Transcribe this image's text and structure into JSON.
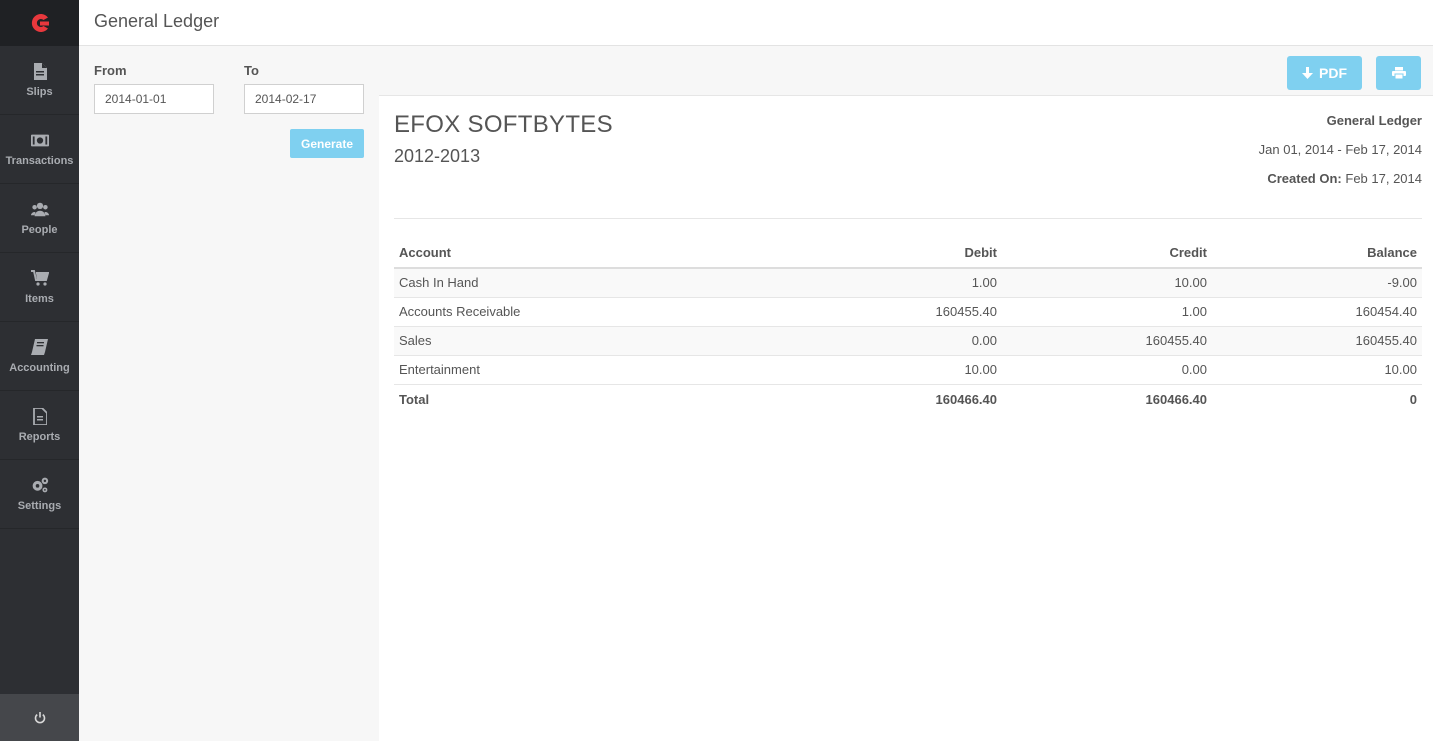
{
  "sidebar": {
    "items": [
      {
        "label": "Slips",
        "icon": "file-icon"
      },
      {
        "label": "Transactions",
        "icon": "money-icon"
      },
      {
        "label": "People",
        "icon": "people-icon"
      },
      {
        "label": "Items",
        "icon": "cart-icon"
      },
      {
        "label": "Accounting",
        "icon": "book-icon"
      },
      {
        "label": "Reports",
        "icon": "report-icon"
      },
      {
        "label": "Settings",
        "icon": "gears-icon"
      }
    ]
  },
  "header": {
    "title": "General Ledger"
  },
  "filter": {
    "from_label": "From",
    "from_value": "2014-01-01",
    "to_label": "To",
    "to_value": "2014-02-17",
    "generate_label": "Generate"
  },
  "toolbar": {
    "pdf_label": "PDF"
  },
  "report": {
    "company": "EFOX SOFTBYTES",
    "fiscal_year": "2012-2013",
    "title": "General Ledger",
    "period": "Jan 01, 2014 - Feb 17, 2014",
    "created_label": "Created On:",
    "created_value": "Feb 17, 2014"
  },
  "table": {
    "headers": [
      "Account",
      "Debit",
      "Credit",
      "Balance"
    ],
    "rows": [
      [
        "Cash In Hand",
        "1.00",
        "10.00",
        "-9.00"
      ],
      [
        "Accounts Receivable",
        "160455.40",
        "1.00",
        "160454.40"
      ],
      [
        "Sales",
        "0.00",
        "160455.40",
        "160455.40"
      ],
      [
        "Entertainment",
        "10.00",
        "0.00",
        "10.00"
      ]
    ],
    "total": [
      "Total",
      "160466.40",
      "160466.40",
      "0"
    ]
  },
  "colors": {
    "accent": "#7fd0f0",
    "brand": "#e8383d",
    "sidebar": "#2d2f33"
  }
}
